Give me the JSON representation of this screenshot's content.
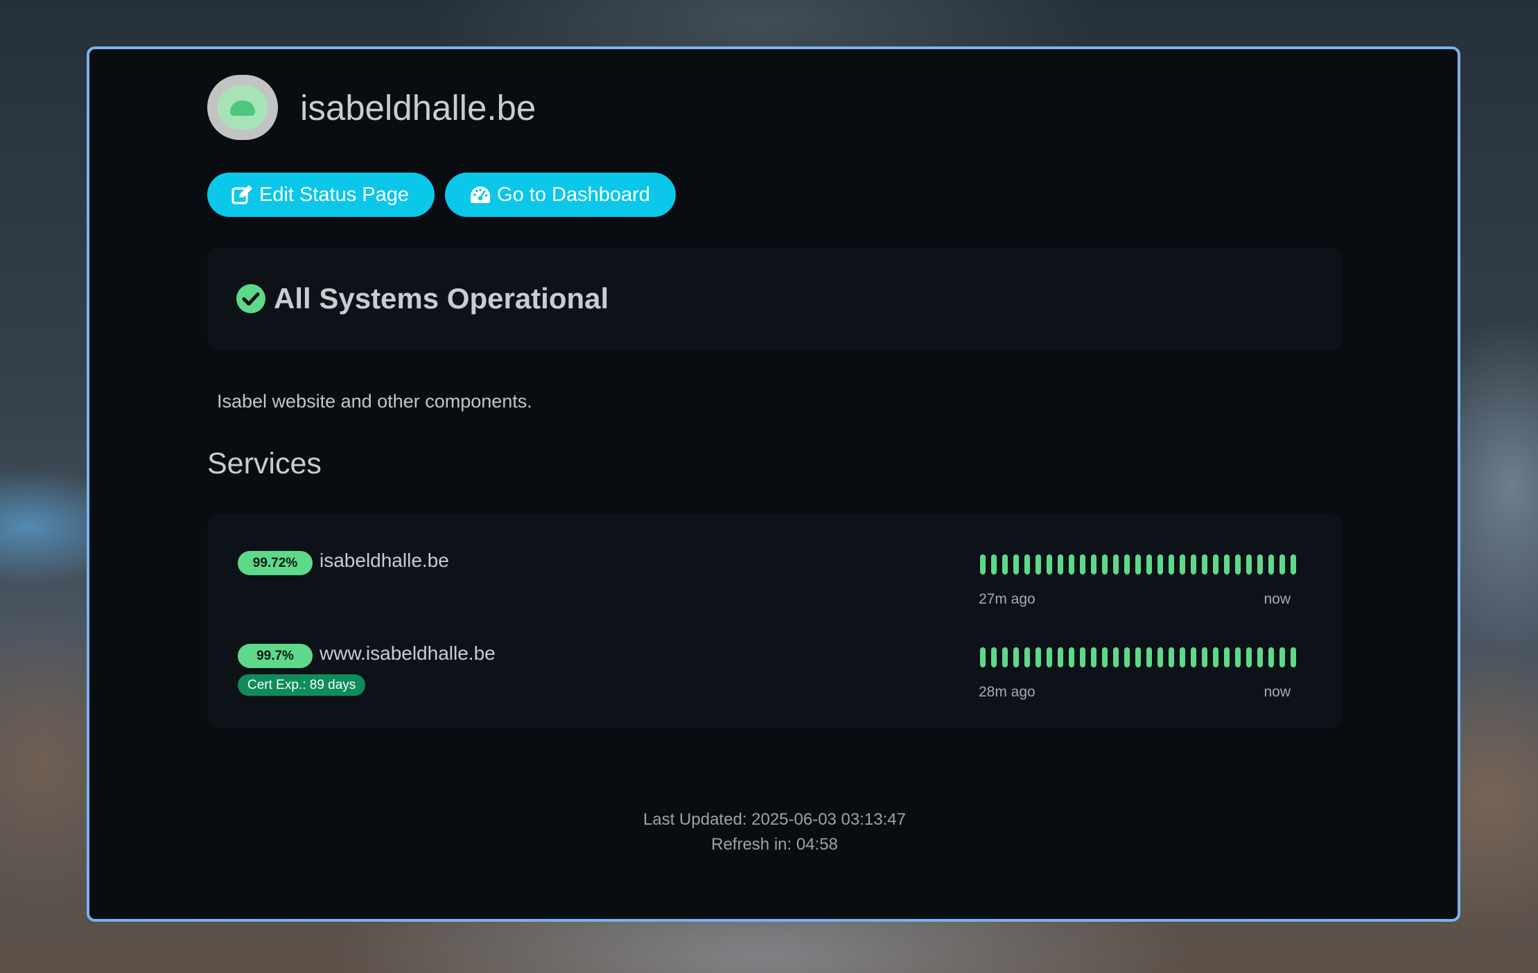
{
  "header": {
    "title": "isabeldhalle.be",
    "logo_icon": "status-logo-icon"
  },
  "buttons": {
    "edit": {
      "label": "Edit Status Page",
      "icon": "edit-icon"
    },
    "dashboard": {
      "label": "Go to Dashboard",
      "icon": "dashboard-gauge-icon"
    }
  },
  "status": {
    "message": "All Systems Operational",
    "icon": "check-circle-icon",
    "color": "#5ed98a"
  },
  "description": "Isabel website and other components.",
  "services_title": "Services",
  "services": [
    {
      "uptime": "99.72%",
      "name": "isabeldhalle.be",
      "cert": "",
      "time_start": "27m ago",
      "time_end": "now",
      "heartbeats_up": 29
    },
    {
      "uptime": "99.7%",
      "name": "www.isabeldhalle.be",
      "cert": "Cert Exp.: 89 days",
      "time_start": "28m ago",
      "time_end": "now",
      "heartbeats_up": 29
    }
  ],
  "footer": {
    "last_updated": "Last Updated: 2025-06-03 03:13:47",
    "refresh": "Refresh in: 04:58"
  },
  "colors": {
    "accent": "#0bc7ea",
    "up": "#5ed98a",
    "cert": "#0e8c5a",
    "window_border": "#78b4ee"
  }
}
